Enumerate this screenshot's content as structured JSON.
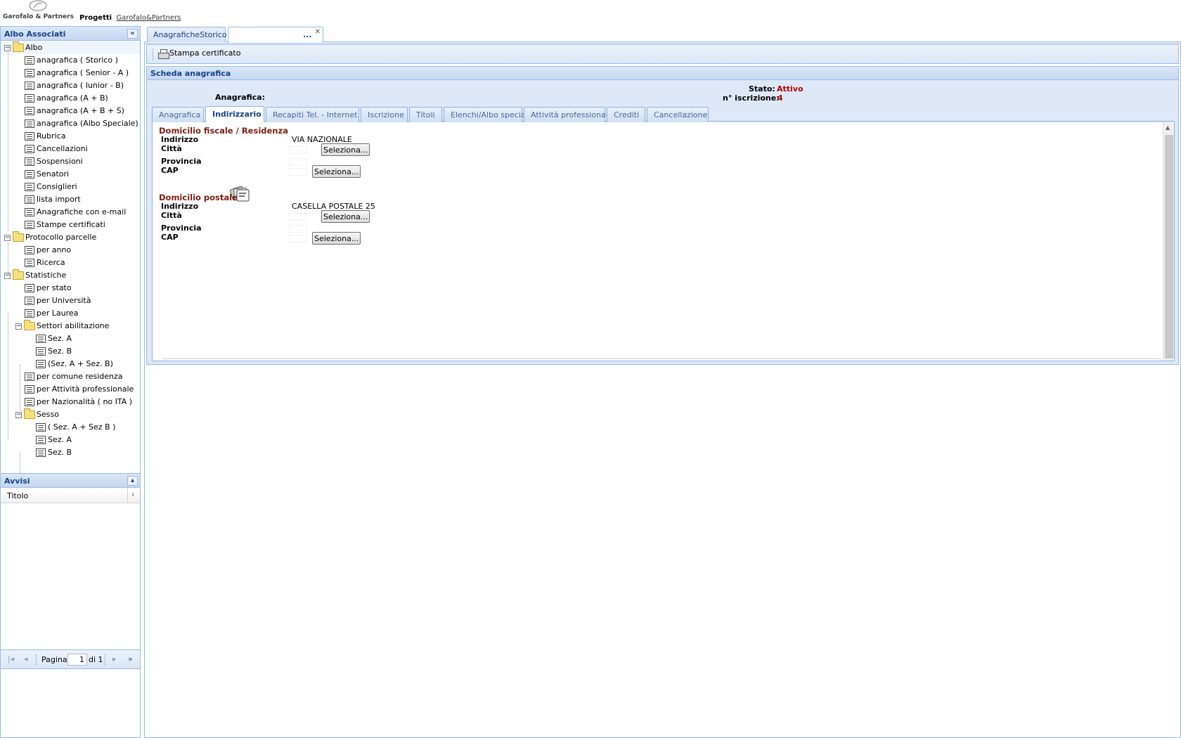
{
  "header": {
    "logo_text": "Garofalo & Partners",
    "title_prefix": "Progetti",
    "title_link": "Garofalo&Partners"
  },
  "west": {
    "title": "Albo Associati",
    "collapse_icon": "double-chevron-left-icon",
    "tree": [
      {
        "label": "Albo",
        "type": "folder",
        "level": 0
      },
      {
        "label": "anagrafica ( Storico )",
        "type": "leaf",
        "level": 1
      },
      {
        "label": "anagrafica ( Senior - A )",
        "type": "leaf",
        "level": 1
      },
      {
        "label": "anagrafica ( Iunior - B)",
        "type": "leaf",
        "level": 1
      },
      {
        "label": "anagrafica (A + B)",
        "type": "leaf",
        "level": 1
      },
      {
        "label": "anagrafica (A + B + S)",
        "type": "leaf",
        "level": 1
      },
      {
        "label": "anagrafica (Albo Speciale)",
        "type": "leaf",
        "level": 1
      },
      {
        "label": "Rubrica",
        "type": "leaf",
        "level": 1
      },
      {
        "label": "Cancellazioni",
        "type": "leaf",
        "level": 1
      },
      {
        "label": "Sospensioni",
        "type": "leaf",
        "level": 1
      },
      {
        "label": "Senatori",
        "type": "leaf",
        "level": 1
      },
      {
        "label": "Consiglieri",
        "type": "leaf",
        "level": 1
      },
      {
        "label": "lista import",
        "type": "leaf",
        "level": 1
      },
      {
        "label": "Anagrafiche con e-mail",
        "type": "leaf",
        "level": 1
      },
      {
        "label": "Stampe certificati",
        "type": "leaf",
        "level": 1
      },
      {
        "label": "Protocollo parcelle",
        "type": "folder",
        "level": 0
      },
      {
        "label": "per anno",
        "type": "leaf",
        "level": 1
      },
      {
        "label": "Ricerca",
        "type": "leaf",
        "level": 1
      },
      {
        "label": "Statistiche",
        "type": "folder",
        "level": 0
      },
      {
        "label": "per stato",
        "type": "leaf",
        "level": 1
      },
      {
        "label": "per Università",
        "type": "leaf",
        "level": 1
      },
      {
        "label": "per Laurea",
        "type": "leaf",
        "level": 1
      },
      {
        "label": "Settori abilitazione",
        "type": "folder",
        "level": 1
      },
      {
        "label": "Sez. A",
        "type": "leaf",
        "level": 2
      },
      {
        "label": "Sez. B",
        "type": "leaf",
        "level": 2
      },
      {
        "label": "(Sez. A + Sez. B)",
        "type": "leaf",
        "level": 2
      },
      {
        "label": "per comune residenza",
        "type": "leaf",
        "level": 1
      },
      {
        "label": "per Attività professionale",
        "type": "leaf",
        "level": 1
      },
      {
        "label": "per Nazionalità ( no ITA )",
        "type": "leaf",
        "level": 1
      },
      {
        "label": "Sesso",
        "type": "folder",
        "level": 1
      },
      {
        "label": "( Sez. A + Sez B )",
        "type": "leaf",
        "level": 2
      },
      {
        "label": "Sez. A",
        "type": "leaf",
        "level": 2
      },
      {
        "label": "Sez. B",
        "type": "leaf",
        "level": 2
      }
    ],
    "avvisi": {
      "title": "Avvisi",
      "column": "Titolo",
      "pager_label": "Pagina",
      "page_value": "1",
      "page_of": "di 1"
    }
  },
  "center": {
    "tabs": [
      {
        "label": "AnagraficheStorico"
      },
      {
        "label": "..."
      }
    ],
    "toolbar": {
      "print_label": "Stampa certificato"
    },
    "scheda": {
      "title": "Scheda anagrafica",
      "anagrafica_label": "Anagrafica:",
      "stato_label": "Stato:",
      "stato_value": "Attivo",
      "iscrizione_label": "n° iscrizione:",
      "iscrizione_value": "4"
    },
    "inner_tabs": [
      "Anagrafica",
      "Indirizzario",
      "Recapiti Tel. - Internet",
      "Iscrizione",
      "Titoli",
      "Elenchi/Albo speciali",
      "Attività professionali",
      "Crediti",
      "Cancellazione"
    ],
    "active_inner_tab": "Indirizzario",
    "sections": [
      {
        "title": "Domicilio fiscale / Residenza",
        "indirizzo_label": "Indirizzo",
        "indirizzo_value": "VIA NAZIONALE",
        "citta_label": "Città",
        "provincia_label": "Provincia",
        "cap_label": "CAP",
        "btn1": "Seleziona...",
        "btn2": "Seleziona..."
      },
      {
        "title": "Domicilio postale",
        "indirizzo_label": "Indirizzo",
        "indirizzo_value": "CASELLA POSTALE 25",
        "citta_label": "Città",
        "provincia_label": "Provincia",
        "cap_label": "CAP",
        "btn1": "Seleziona...",
        "btn2": "Seleziona..."
      }
    ]
  }
}
